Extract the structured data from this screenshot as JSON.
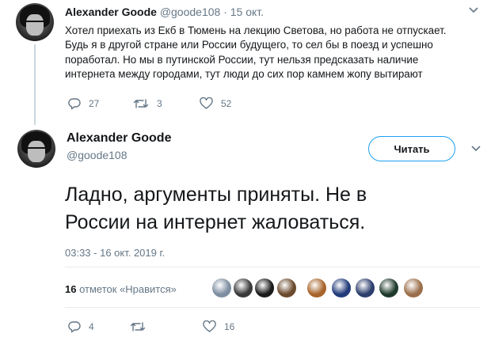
{
  "tweet1": {
    "name": "Alexander Goode",
    "meta": "@goode108 · 15 окт.",
    "lines": [
      "Хотел приехать из Екб в Тюмень на лекцию Светова, но работа не отпускает.",
      "Будь я в другой стране или России будущего, то сел бы в поезд и успешно",
      "поработал. Но мы в путинской России, тут нельзя предсказать наличие",
      "интернета между городами, тут люди до сих пор камнем жопу вытирают"
    ],
    "actions": {
      "replies": "27",
      "retweets": "3",
      "likes": "52"
    }
  },
  "tweet2": {
    "name": "Alexander Goode",
    "handle": "@goode108",
    "follow_label": "Читать",
    "lines": [
      "Ладно, аргументы приняты. Не в",
      "России на интернет жаловаться."
    ],
    "timestamp": "03:33 - 16 окт. 2019 г.",
    "likes_number": "16",
    "likes_text": "отметок «Нравится»",
    "liker_colors": [
      "#7e8ea1",
      "#3a3a3a",
      "#1b1b1b",
      "#6b4a2e",
      "#a7652b",
      "#223b7a",
      "#2d3e6d",
      "#1f3a2c",
      "#9b6f4b"
    ],
    "actions": {
      "replies": "4",
      "retweets": "",
      "likes": "16"
    }
  },
  "colors": {
    "accent": "#1da1f2",
    "secondary_text": "#657786",
    "divider": "#e6ecf0"
  }
}
